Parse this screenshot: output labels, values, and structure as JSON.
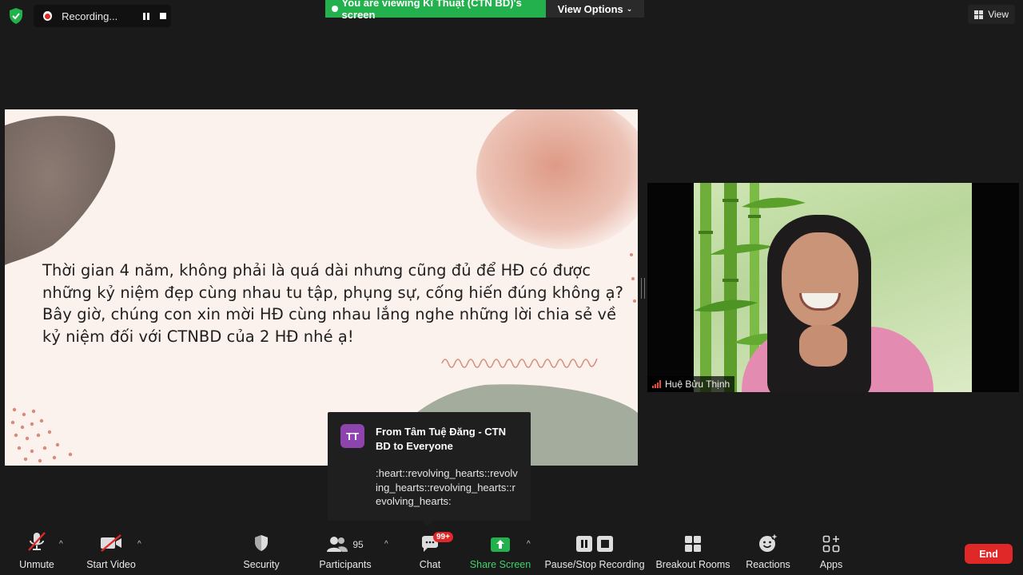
{
  "topbar": {
    "recording_label": "Recording...",
    "viewing_banner": "You are viewing Kĩ Thuật (CTN BD)'s screen",
    "view_options_label": "View Options",
    "view_label": "View"
  },
  "slide": {
    "text": "Thời gian 4 năm, không phải là quá dài nhưng cũng đủ để HĐ có được những kỷ niệm đẹp cùng nhau tu tập, phụng sự, cống hiến đúng không ạ? Bây giờ, chúng con xin mời HĐ cùng nhau lắng nghe những lời chia sẻ về kỷ niệm đối với CTNBD của 2 HĐ nhé ạ!"
  },
  "video": {
    "participant_name": "Huệ Bửu Thịnh"
  },
  "chat_toast": {
    "avatar_initials": "TT",
    "from": "From Tâm Tuệ Đăng - CTN BD to Everyone",
    "message": ":heart::revolving_hearts::revolving_hearts::revolving_hearts::revolving_hearts:"
  },
  "toolbar": {
    "unmute": "Unmute",
    "start_video": "Start Video",
    "security": "Security",
    "participants": "Participants",
    "participants_count": "95",
    "chat": "Chat",
    "chat_badge": "99+",
    "share_screen": "Share Screen",
    "pause_stop_recording": "Pause/Stop Recording",
    "breakout_rooms": "Breakout Rooms",
    "reactions": "Reactions",
    "apps": "Apps",
    "end": "End"
  },
  "colors": {
    "accent_green": "#23b14d",
    "end_red": "#e02828",
    "avatar_purple": "#8e44ad"
  }
}
